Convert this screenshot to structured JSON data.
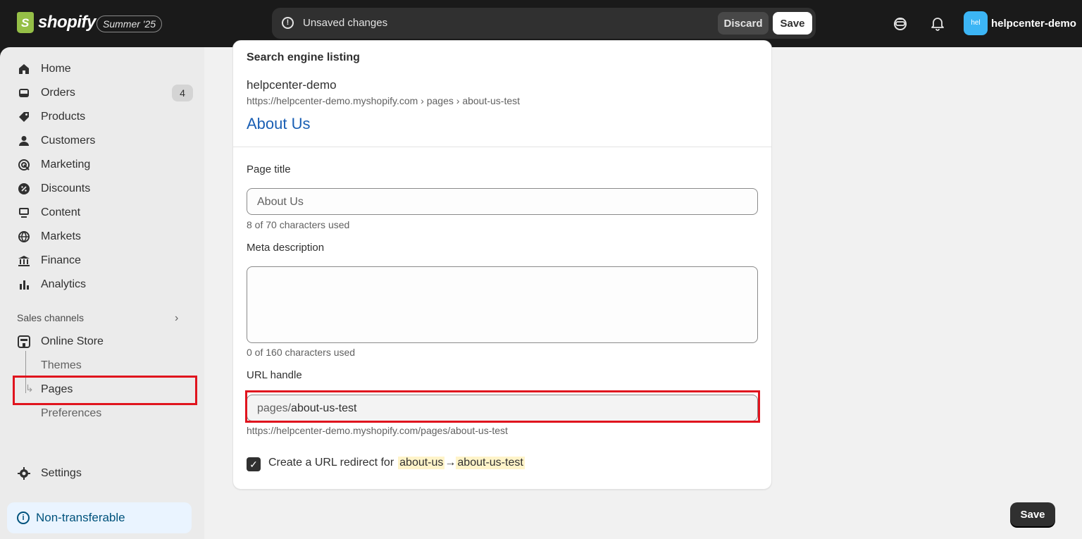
{
  "topbar": {
    "brand": "shopify",
    "edition": "Summer '25",
    "unsaved_text": "Unsaved changes",
    "discard_label": "Discard",
    "save_label": "Save",
    "avatar_initials": "hel",
    "store_name": "helpcenter-demo"
  },
  "sidebar": {
    "items": [
      {
        "label": "Home",
        "icon": "home-icon"
      },
      {
        "label": "Orders",
        "icon": "inbox-icon",
        "badge": "4"
      },
      {
        "label": "Products",
        "icon": "tag-icon"
      },
      {
        "label": "Customers",
        "icon": "person-icon"
      },
      {
        "label": "Marketing",
        "icon": "target-icon"
      },
      {
        "label": "Discounts",
        "icon": "discount-icon"
      },
      {
        "label": "Content",
        "icon": "content-icon"
      },
      {
        "label": "Markets",
        "icon": "globe-icon"
      },
      {
        "label": "Finance",
        "icon": "bank-icon"
      },
      {
        "label": "Analytics",
        "icon": "chart-icon"
      }
    ],
    "sales_channels_label": "Sales channels",
    "online_store_label": "Online Store",
    "sub_items": [
      "Themes",
      "Pages",
      "Preferences"
    ],
    "settings_label": "Settings",
    "non_transferable_label": "Non-transferable"
  },
  "seo": {
    "section_title": "Search engine listing",
    "preview_store": "helpcenter-demo",
    "preview_url": "https://helpcenter-demo.myshopify.com › pages › about-us-test",
    "preview_title": "About Us",
    "page_title_label": "Page title",
    "page_title_value": "About Us",
    "page_title_helper": "8 of 70 characters used",
    "meta_label": "Meta description",
    "meta_value": "",
    "meta_helper": "0 of 160 characters used",
    "url_handle_label": "URL handle",
    "url_prefix": "pages/",
    "url_value": "about-us-test",
    "url_full": "https://helpcenter-demo.myshopify.com/pages/about-us-test",
    "redirect_text": "Create a URL redirect for",
    "redirect_from": "about-us",
    "redirect_arrow": "→",
    "redirect_to": "about-us-test",
    "redirect_checked": true
  },
  "footer": {
    "save_label": "Save"
  }
}
